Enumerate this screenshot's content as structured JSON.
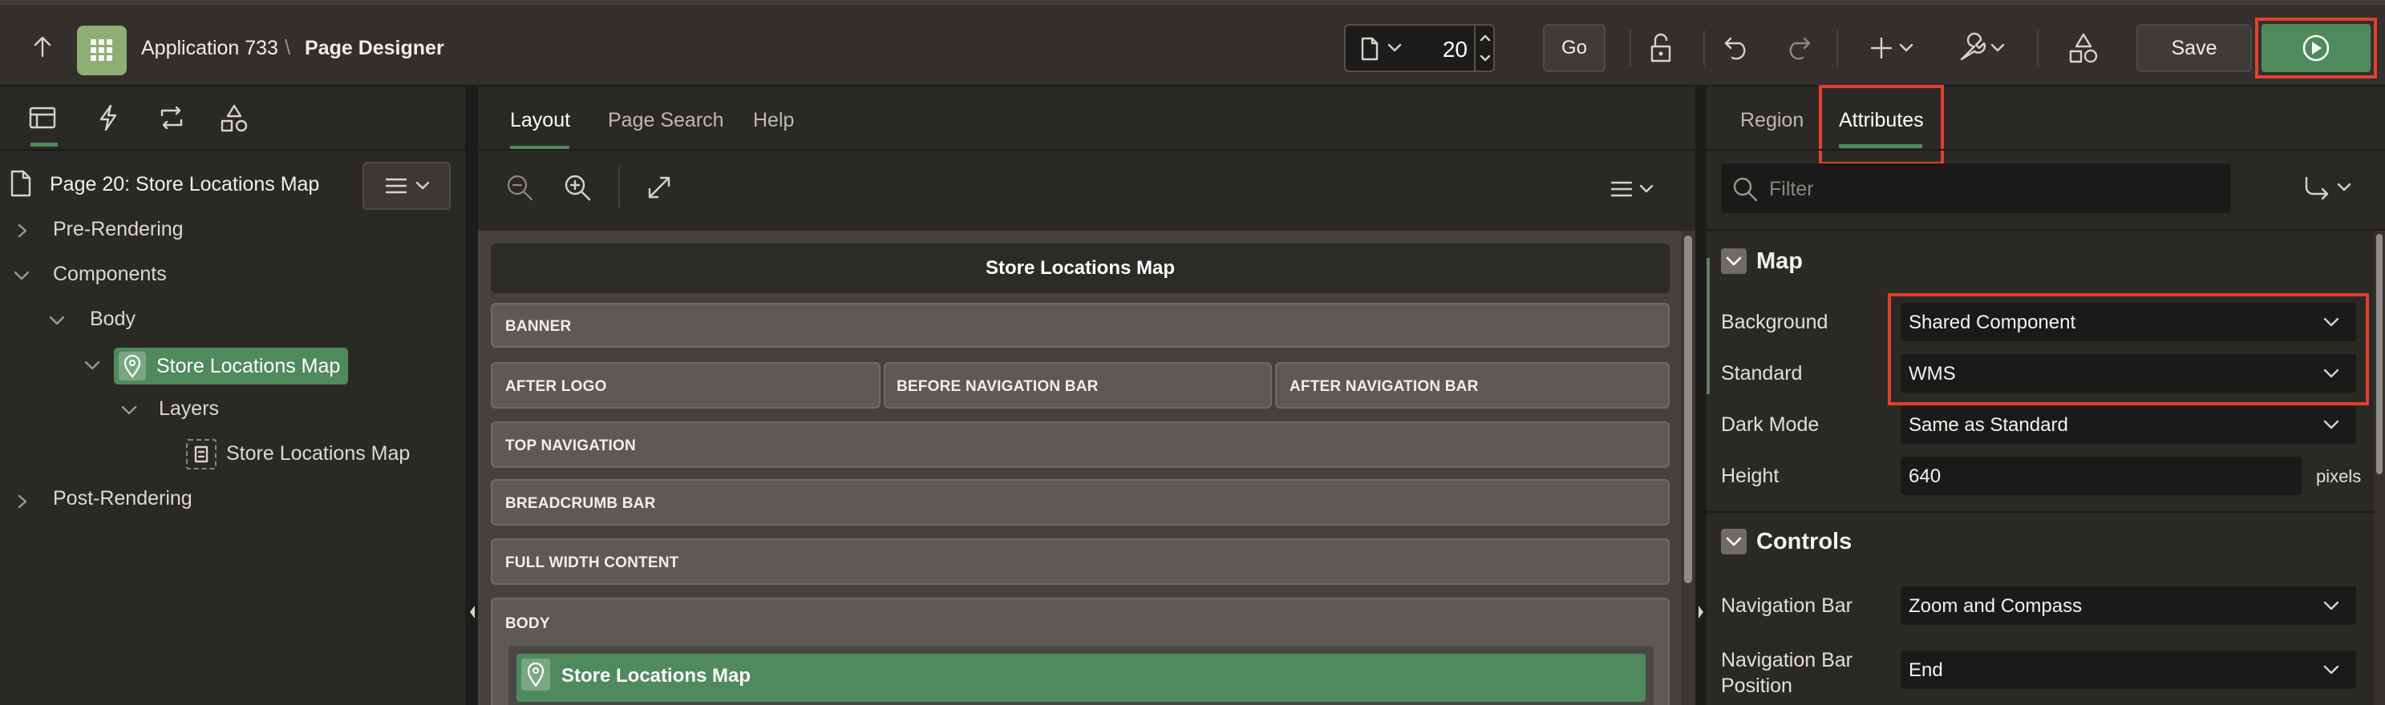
{
  "header": {
    "app_name": "Application 733",
    "separator": "\\",
    "page_designer_label": "Page Designer",
    "page_number": "20",
    "go_label": "Go",
    "save_label": "Save"
  },
  "left_panel": {
    "page_title": "Page 20: Store Locations Map",
    "tree": {
      "pre_rendering": "Pre-Rendering",
      "components": "Components",
      "body": "Body",
      "region": "Store Locations Map",
      "layers": "Layers",
      "layer_item": "Store Locations Map",
      "post_rendering": "Post-Rendering"
    }
  },
  "middle_panel": {
    "tabs": [
      "Layout",
      "Page Search",
      "Help"
    ],
    "layout": {
      "page_title": "Store Locations Map",
      "banner": "BANNER",
      "after_logo": "AFTER LOGO",
      "before_navigation_bar": "BEFORE NAVIGATION BAR",
      "after_navigation_bar": "AFTER NAVIGATION BAR",
      "top_navigation": "TOP NAVIGATION",
      "breadcrumb_bar": "BREADCRUMB BAR",
      "full_width_content": "FULL WIDTH CONTENT",
      "body": "BODY",
      "body_region": "Store Locations Map"
    }
  },
  "right_panel": {
    "tabs": [
      "Region",
      "Attributes"
    ],
    "filter_placeholder": "Filter",
    "sections": {
      "map": {
        "title": "Map",
        "background_label": "Background",
        "background_value": "Shared Component",
        "standard_label": "Standard",
        "standard_value": "WMS",
        "dark_mode_label": "Dark Mode",
        "dark_mode_value": "Same as Standard",
        "height_label": "Height",
        "height_value": "640",
        "height_unit": "pixels"
      },
      "controls": {
        "title": "Controls",
        "navigation_bar_label": "Navigation Bar",
        "navigation_bar_value": "Zoom and Compass",
        "navigation_bar_position_label": "Navigation Bar Position",
        "navigation_bar_position_value": "End"
      }
    }
  },
  "colors": {
    "accent_green": "#4f8a5c",
    "highlight_red": "#e0402c",
    "header_bg": "#322f2c",
    "panel_bg": "#2b2926"
  }
}
